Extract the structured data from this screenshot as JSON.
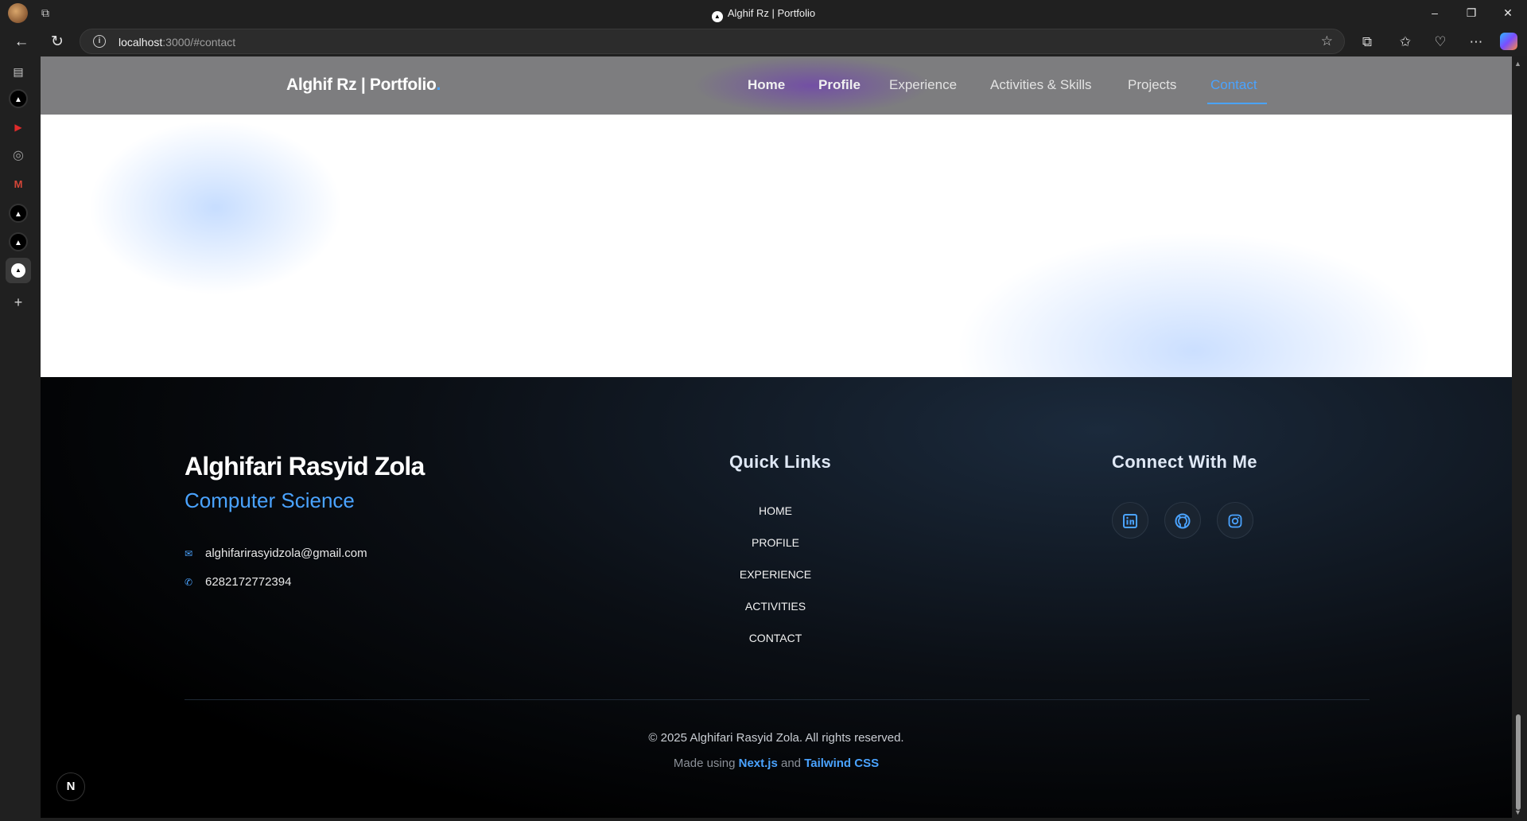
{
  "browser": {
    "window_title": "Alghif Rz | Portfolio",
    "url_host": "localhost",
    "url_rest": ":3000/#contact",
    "controls": {
      "minimize": "–",
      "restore": "❐",
      "close": "✕"
    }
  },
  "nav": {
    "brand": "Alghif Rz | Portfolio",
    "brand_dot": ".",
    "links": [
      {
        "label": "Home"
      },
      {
        "label": "Profile"
      },
      {
        "label": "Experience"
      },
      {
        "label": "Activities & Skills"
      },
      {
        "label": "Projects"
      },
      {
        "label": "Contact"
      }
    ],
    "active_link": "Contact",
    "accent_color": "#4aa3ff"
  },
  "footer": {
    "name": "Alghifari Rasyid Zola",
    "role": "Computer Science",
    "email": "alghifarirasyidzola@gmail.com",
    "phone": "6282172772394",
    "quick_links_title": "Quick Links",
    "quick_links": [
      "HOME",
      "PROFILE",
      "EXPERIENCE",
      "ACTIVITIES",
      "CONTACT"
    ],
    "connect_title": "Connect With Me",
    "socials": [
      "linkedin-icon",
      "github-icon",
      "instagram-icon"
    ],
    "copyright": "© 2025 Alghifari Rasyid Zola. All rights reserved.",
    "made_using_prefix": "Made using",
    "made_using_tech1": "Next.js",
    "made_using_and": "and",
    "made_using_tech2": "Tailwind CSS"
  },
  "dev_badge": "N"
}
